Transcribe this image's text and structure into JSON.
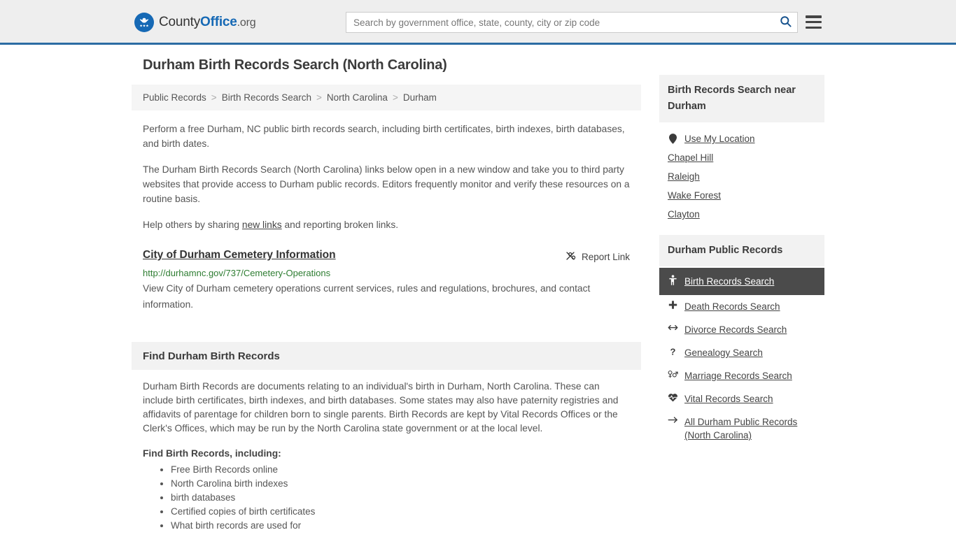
{
  "header": {
    "logo": {
      "icon": "eagle-seal-icon",
      "text_county": "County",
      "text_office": "Office",
      "text_org": ".org"
    },
    "search": {
      "placeholder": "Search by government office, state, county, city or zip code",
      "value": "",
      "button_icon": "search-icon"
    },
    "menu_icon": "hamburger-menu-icon"
  },
  "page": {
    "title": "Durham Birth Records Search (North Carolina)"
  },
  "breadcrumb": {
    "separator": ">",
    "items": [
      {
        "label": "Public Records"
      },
      {
        "label": "Birth Records Search"
      },
      {
        "label": "North Carolina"
      },
      {
        "label": "Durham"
      }
    ]
  },
  "intro": {
    "p1": "Perform a free Durham, NC public birth records search, including birth certificates, birth indexes, birth databases, and birth dates.",
    "p2": "The Durham Birth Records Search (North Carolina) links below open in a new window and take you to third party websites that provide access to Durham public records. Editors frequently monitor and verify these resources on a routine basis.",
    "p3_before": "Help others by sharing ",
    "p3_link": "new links",
    "p3_after": " and reporting broken links."
  },
  "listing": {
    "title": "City of Durham Cemetery Information",
    "report_label": "Report Link",
    "report_icon": "unlink-broken-chain-icon",
    "url": "http://durhamnc.gov/737/Cemetery-Operations",
    "description": "View City of Durham cemetery operations current services, rules and regulations, brochures, and contact information."
  },
  "find_section": {
    "heading": "Find Durham Birth Records",
    "body": "Durham Birth Records are documents relating to an individual's birth in Durham, North Carolina. These can include birth certificates, birth indexes, and birth databases. Some states may also have paternity registries and affidavits of parentage for children born to single parents. Birth Records are kept by Vital Records Offices or the Clerk's Offices, which may be run by the North Carolina state government or at the local level.",
    "sub_heading": "Find Birth Records, including:",
    "bullets": [
      "Free Birth Records online",
      "North Carolina birth indexes",
      "birth databases",
      "Certified copies of birth certificates",
      "What birth records are used for"
    ]
  },
  "sidebar": {
    "near": {
      "heading": "Birth Records Search near Durham",
      "items": [
        {
          "label": "Use My Location",
          "icon": "map-pin-icon"
        },
        {
          "label": "Chapel Hill",
          "icon": ""
        },
        {
          "label": "Raleigh",
          "icon": ""
        },
        {
          "label": "Wake Forest",
          "icon": ""
        },
        {
          "label": "Clayton",
          "icon": ""
        }
      ]
    },
    "public_records": {
      "heading": "Durham Public Records",
      "items": [
        {
          "label": "Birth Records Search",
          "icon": "baby-child-icon",
          "active": true
        },
        {
          "label": "Death Records Search",
          "icon": "cross-plus-icon",
          "active": false
        },
        {
          "label": "Divorce Records Search",
          "icon": "arrows-left-right-icon",
          "active": false
        },
        {
          "label": "Genealogy Search",
          "icon": "question-mark-icon",
          "active": false
        },
        {
          "label": "Marriage Records Search",
          "icon": "venus-mars-icon",
          "active": false
        },
        {
          "label": "Vital Records Search",
          "icon": "heartbeat-heart-icon",
          "active": false
        },
        {
          "label": "All Durham Public Records (North Carolina)",
          "icon": "arrow-right-icon",
          "active": false
        }
      ]
    }
  },
  "colors": {
    "brand_blue": "#1669b5",
    "header_border": "#2b6ca3",
    "header_bg": "#eeeeee",
    "url_green": "#2e7d32",
    "active_item_bg": "#4b4b4b",
    "panel_gray": "#f2f2f2"
  }
}
